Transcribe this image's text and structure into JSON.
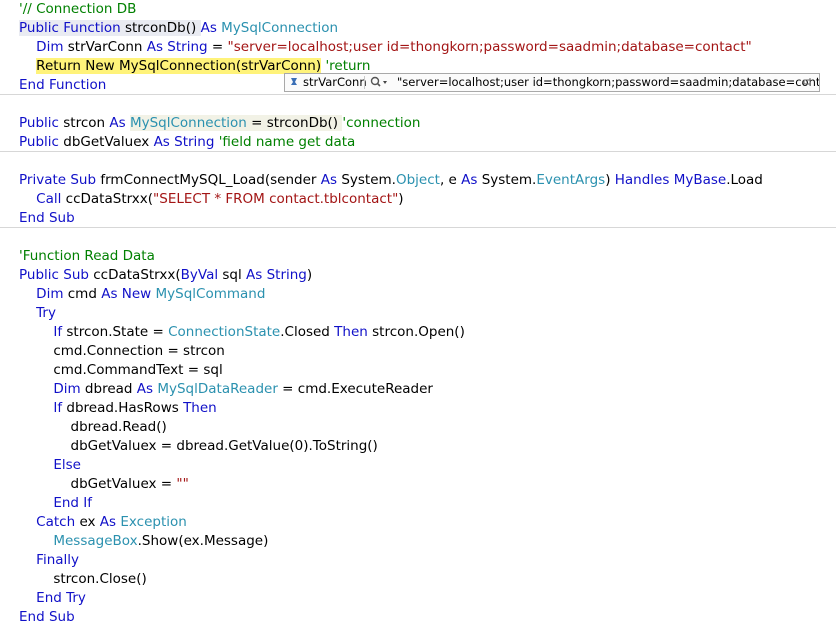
{
  "editor": {
    "lines": [
      [
        [
          "// Connection DB",
          "cm"
        ]
      ],
      [
        [
          "Public Function",
          "kw"
        ],
        [
          " strconDb() ",
          ""
        ],
        [
          "As",
          "kw"
        ],
        [
          " ",
          ""
        ],
        [
          "MySqlConnection",
          "ty"
        ]
      ],
      [
        [
          "    ",
          ""
        ],
        [
          "Dim",
          "kw"
        ],
        [
          " strVarConn ",
          ""
        ],
        [
          "As String",
          "kw"
        ],
        [
          " = ",
          ""
        ],
        [
          "\"server=localhost;user id=thongkorn;password=saadmin;database=contact\"",
          "str"
        ]
      ],
      [
        [
          "    ",
          ""
        ],
        [
          "Return New MySqlConnection(strVarConn)",
          "ret"
        ],
        [
          " ",
          ""
        ],
        [
          "'return",
          "cm"
        ]
      ],
      [
        [
          "End Function",
          "kw"
        ]
      ],
      [],
      [
        [
          "Public",
          "kw"
        ],
        [
          " strcon ",
          ""
        ],
        [
          "As",
          "kw"
        ],
        [
          " ",
          ""
        ],
        [
          "MySqlConnection",
          "ty"
        ],
        [
          " = strconDb() ",
          ""
        ],
        [
          "'connection",
          "cm"
        ]
      ],
      [
        [
          "Public",
          "kw"
        ],
        [
          " dbGetValuex ",
          ""
        ],
        [
          "As String",
          "kw"
        ],
        [
          " ",
          ""
        ],
        [
          "'field name get data",
          "cm"
        ]
      ],
      [],
      [
        [
          "Private Sub",
          "kw"
        ],
        [
          " frmConnectMySQL_Load(sender ",
          ""
        ],
        [
          "As",
          "kw"
        ],
        [
          " System.",
          ""
        ],
        [
          "Object",
          "ty"
        ],
        [
          ", e ",
          ""
        ],
        [
          "As",
          "kw"
        ],
        [
          " System.",
          ""
        ],
        [
          "EventArgs",
          "ty"
        ],
        [
          ") ",
          ""
        ],
        [
          "Handles",
          "kw"
        ],
        [
          " ",
          ""
        ],
        [
          "MyBase",
          "kw"
        ],
        [
          ".Load",
          ""
        ]
      ],
      [
        [
          "    ",
          ""
        ],
        [
          "Call",
          "kw"
        ],
        [
          " ccDataStrxx(",
          ""
        ],
        [
          "\"SELECT * FROM contact.tblcontact\"",
          "str"
        ],
        [
          ")",
          ""
        ]
      ],
      [
        [
          "End Sub",
          "kw"
        ]
      ],
      [],
      [
        [
          "'Function Read Data",
          "cm"
        ]
      ],
      [
        [
          "Public Sub",
          "kw"
        ],
        [
          " ccDataStrxx(",
          ""
        ],
        [
          "ByVal",
          "kw"
        ],
        [
          " sql ",
          ""
        ],
        [
          "As String",
          "kw"
        ],
        [
          ")",
          ""
        ]
      ],
      [
        [
          "    ",
          ""
        ],
        [
          "Dim",
          "kw"
        ],
        [
          " cmd ",
          ""
        ],
        [
          "As New",
          "kw"
        ],
        [
          " ",
          ""
        ],
        [
          "MySqlCommand",
          "ty"
        ]
      ],
      [
        [
          "    ",
          ""
        ],
        [
          "Try",
          "kw"
        ]
      ],
      [
        [
          "        ",
          ""
        ],
        [
          "If",
          "kw"
        ],
        [
          " strcon.State = ",
          ""
        ],
        [
          "ConnectionState",
          "ty"
        ],
        [
          ".Closed ",
          ""
        ],
        [
          "Then",
          "kw"
        ],
        [
          " strcon.Open()",
          ""
        ]
      ],
      [
        [
          "        cmd.Connection = strcon",
          ""
        ]
      ],
      [
        [
          "        cmd.CommandText = sql",
          ""
        ]
      ],
      [
        [
          "        ",
          ""
        ],
        [
          "Dim",
          "kw"
        ],
        [
          " dbread ",
          ""
        ],
        [
          "As",
          "kw"
        ],
        [
          " ",
          ""
        ],
        [
          "MySqlDataReader",
          "ty"
        ],
        [
          " = cmd.ExecuteReader",
          ""
        ]
      ],
      [
        [
          "        ",
          ""
        ],
        [
          "If",
          "kw"
        ],
        [
          " dbread.HasRows ",
          ""
        ],
        [
          "Then",
          "kw"
        ]
      ],
      [
        [
          "            dbread.Read()",
          ""
        ]
      ],
      [
        [
          "            dbGetValuex = dbread.GetValue(0).ToString()",
          ""
        ]
      ],
      [
        [
          "        ",
          ""
        ],
        [
          "Else",
          "kw"
        ]
      ],
      [
        [
          "            dbGetValuex = ",
          ""
        ],
        [
          "\"\"",
          "str"
        ]
      ],
      [
        [
          "        ",
          ""
        ],
        [
          "End If",
          "kw"
        ]
      ],
      [
        [
          "    ",
          ""
        ],
        [
          "Catch",
          "kw"
        ],
        [
          " ex ",
          ""
        ],
        [
          "As",
          "kw"
        ],
        [
          " ",
          ""
        ],
        [
          "Exception",
          "ty"
        ]
      ],
      [
        [
          "        ",
          ""
        ],
        [
          "MessageBox",
          "ty"
        ],
        [
          ".Show(ex.Message)",
          ""
        ]
      ],
      [
        [
          "    ",
          ""
        ],
        [
          "Finally",
          "kw"
        ]
      ],
      [
        [
          "        strcon.Close()",
          ""
        ]
      ],
      [
        [
          "    ",
          ""
        ],
        [
          "End Try",
          "kw"
        ]
      ],
      [
        [
          "End Sub",
          "kw"
        ]
      ]
    ]
  },
  "datatip": {
    "variable_name": "strVarConn",
    "value": "\"server=localhost;user id=thongkorn;password=saadmin;database=contact\"",
    "icons": [
      "datatip-icon",
      "magnifier-icon",
      "pin-icon"
    ]
  },
  "colors": {
    "keyword": "#1010c8",
    "type": "#2b91af",
    "string": "#a31515",
    "comment": "#008000",
    "return_highlight": "#fff37a",
    "function_highlight": "#e9ebf2"
  }
}
